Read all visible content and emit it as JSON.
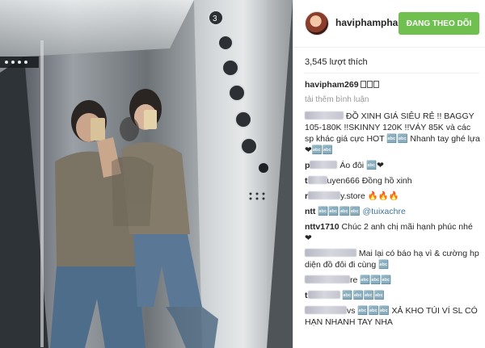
{
  "post": {
    "image": {
      "icon": "elevator-selfie-photo"
    }
  },
  "header": {
    "username": "haviphampham..",
    "follow_label": "ĐANG THEO DÕI",
    "follow_color": "#70c050"
  },
  "likes_text": "3,545 lượt thích",
  "caption": {
    "username": "havipham269",
    "text": "BÁN"
  },
  "load_more": "tải thêm bình luận",
  "comments": [
    {
      "username": "",
      "text": "ĐỒ XINH GIÁ SIÊU RẺ !! BAGGY 105-180K !!SKINNY 120K !!VÁY 85K và các sp khác giá cực HOT 🔤🔤 Nhanh tay ghé lựa ❤🔤🔤"
    },
    {
      "username": "p",
      "text": "Áo đôi 🔤❤"
    },
    {
      "username": "t",
      "text": "uyen666 Đồng hồ xinh"
    },
    {
      "username": "r",
      "text": "y.store 🔥🔥🔥"
    },
    {
      "username": "ntt",
      "text": "🔤🔤🔤🔤 @tuixachre"
    },
    {
      "username": "nttv1710",
      "text": "Chúc 2 anh chị mãi hạnh phúc nhé ❤"
    },
    {
      "username": "",
      "text": "Mai lại có báo hạ vì & cường hp diện đồ đôi đi cùng 🔤"
    },
    {
      "username": "",
      "text": "re 🔤🔤🔤"
    },
    {
      "username": "t",
      "text": "🔤🔤🔤🔤"
    },
    {
      "username": "",
      "text": "vs 🔤🔤🔤 XẢ KHO TÚI VÍ SL CÓ HẠN NHANH TAY NHA"
    }
  ]
}
